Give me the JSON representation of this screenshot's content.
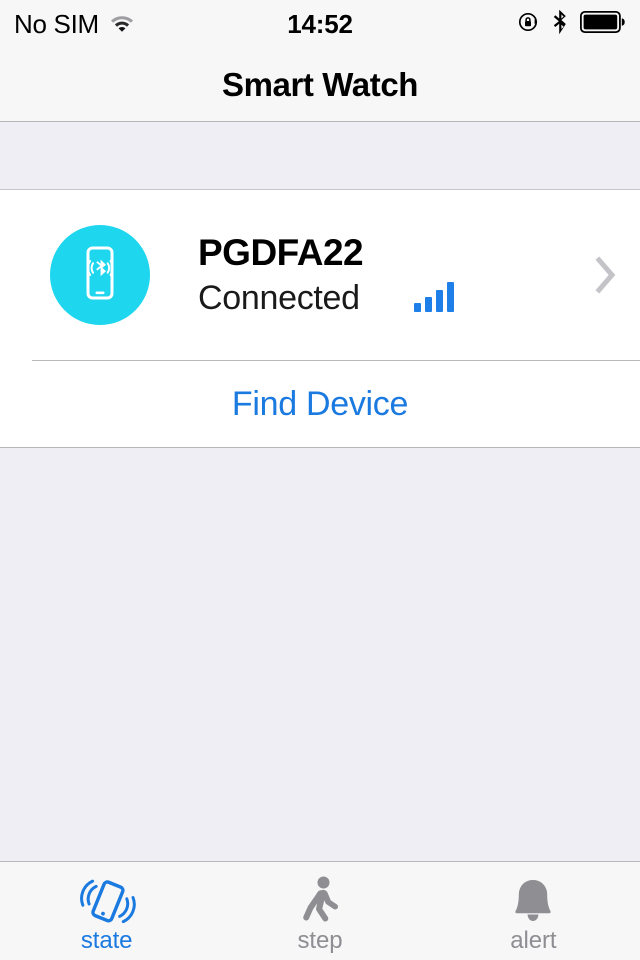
{
  "status_bar": {
    "carrier": "No SIM",
    "time": "14:52",
    "icons": {
      "wifi": "wifi-icon",
      "rotation_lock": "rotation-lock-icon",
      "bluetooth": "bluetooth-icon",
      "battery": "battery-full-icon"
    }
  },
  "navbar": {
    "title": "Smart Watch"
  },
  "device": {
    "avatar_icon": "phone-bluetooth-icon",
    "name": "PGDFA22",
    "status": "Connected",
    "signal_icon": "signal-bars-icon",
    "signal_level": 4,
    "signal_total": 4,
    "disclosure_icon": "chevron-right-icon"
  },
  "find_device": {
    "label": "Find Device"
  },
  "tabbar": {
    "items": [
      {
        "label": "state",
        "icon": "vibrating-phone-icon",
        "active": true
      },
      {
        "label": "step",
        "icon": "walking-person-icon",
        "active": false
      },
      {
        "label": "alert",
        "icon": "bell-icon",
        "active": false
      }
    ]
  },
  "colors": {
    "accent_blue": "#1A7AE0",
    "avatar_cyan": "#1ED6EE",
    "signal_blue": "#1F7FE8",
    "inactive_gray": "#8E8E93",
    "page_background": "#EFEEF4",
    "bar_background": "#F7F7F8",
    "card_background": "#FFFFFF"
  }
}
